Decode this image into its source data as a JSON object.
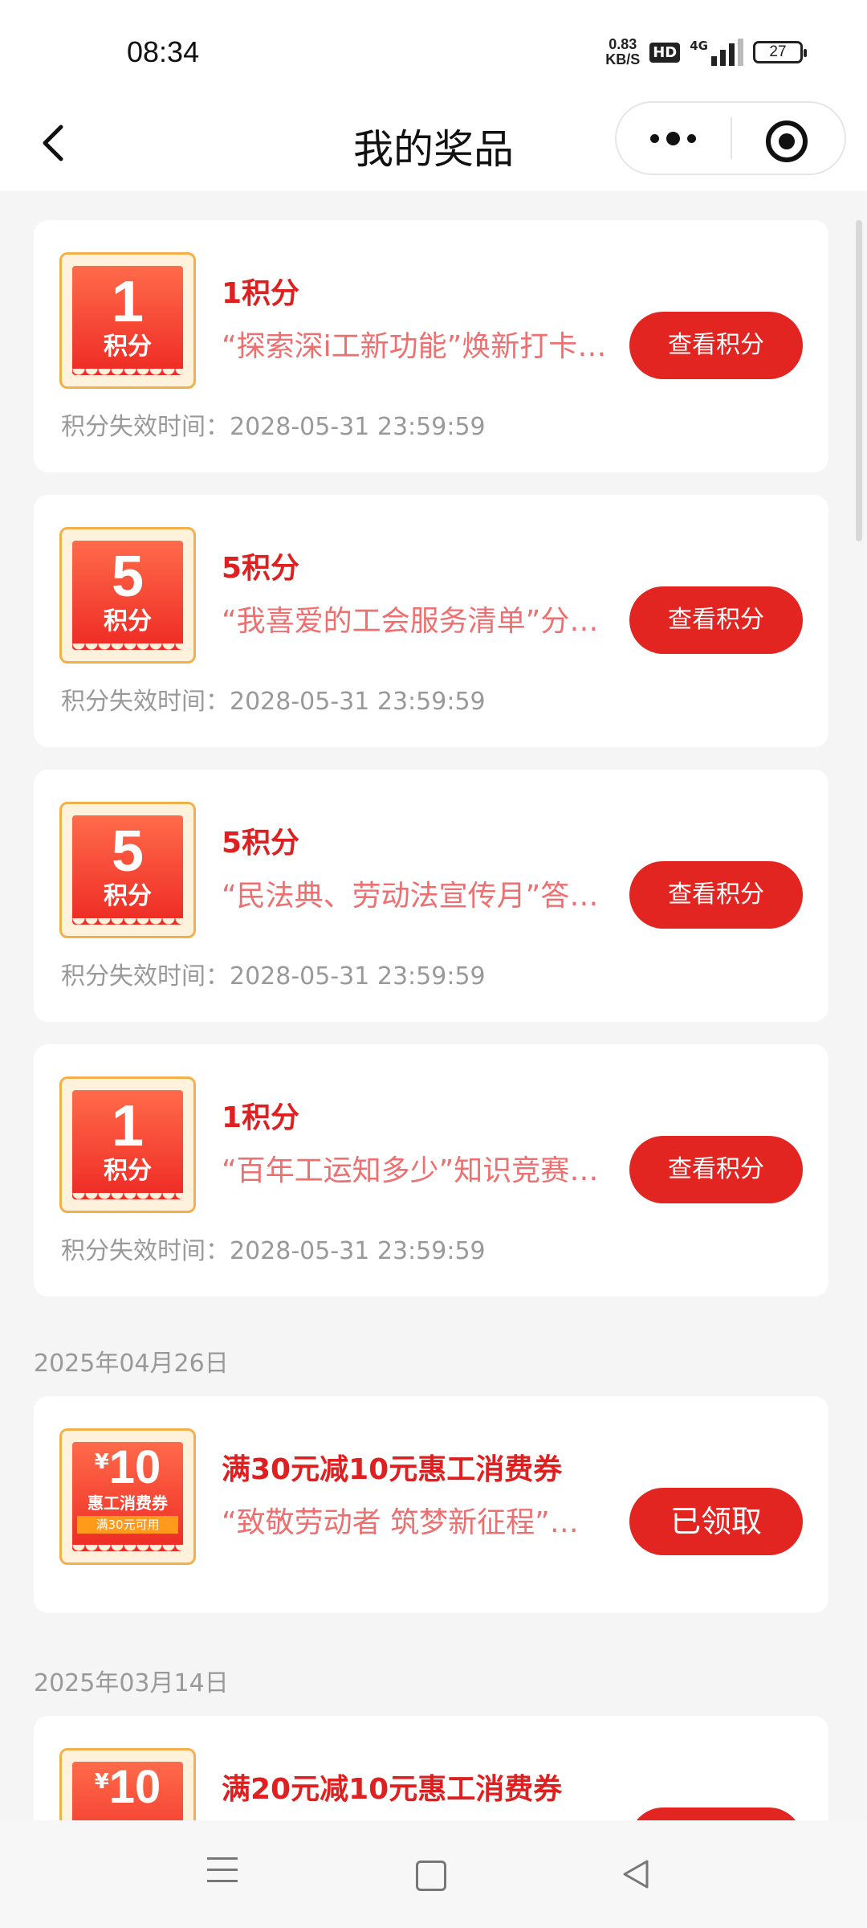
{
  "status_bar": {
    "time": "08:34",
    "speed_value": "0.83",
    "speed_unit": "KB/S",
    "hd": "HD",
    "network": "4G",
    "battery": "27"
  },
  "nav": {
    "title": "我的奖品"
  },
  "items": [
    {
      "badge_num": "1",
      "badge_unit": "积分",
      "title": "1积分",
      "desc": "“探索深i工新功能”焕新打卡赢积分",
      "expire_label": "积分失效时间：",
      "expire_time": "2028-05-31 23:59:59",
      "button": "查看积分"
    },
    {
      "badge_num": "5",
      "badge_unit": "积分",
      "title": "5积分",
      "desc": "“我喜爱的工会服务清单”分享活动",
      "expire_label": "积分失效时间：",
      "expire_time": "2028-05-31 23:59:59",
      "button": "查看积分"
    },
    {
      "badge_num": "5",
      "badge_unit": "积分",
      "title": "5积分",
      "desc": "“民法典、劳动法宣传月”答题活动",
      "expire_label": "积分失效时间：",
      "expire_time": "2028-05-31 23:59:59",
      "button": "查看积分"
    },
    {
      "badge_num": "1",
      "badge_unit": "积分",
      "title": "1积分",
      "desc": "“百年工运知多少”知识竞赛活动",
      "expire_label": "积分失效时间：",
      "expire_time": "2028-05-31 23:59:59",
      "button": "查看积分"
    }
  ],
  "coupon_groups": [
    {
      "date": "2025年04月26日",
      "coupon": {
        "yen": "¥",
        "amount": "10",
        "name": "惠工消费券",
        "min": "满30元可用",
        "title": "满30元减10元惠工消费券",
        "desc": "“致敬劳动者 筑梦新征程”活动",
        "button": "已领取"
      }
    },
    {
      "date": "2025年03月14日",
      "coupon": {
        "yen": "¥",
        "amount": "10",
        "title": "满20元减10元惠工消费券"
      }
    }
  ]
}
